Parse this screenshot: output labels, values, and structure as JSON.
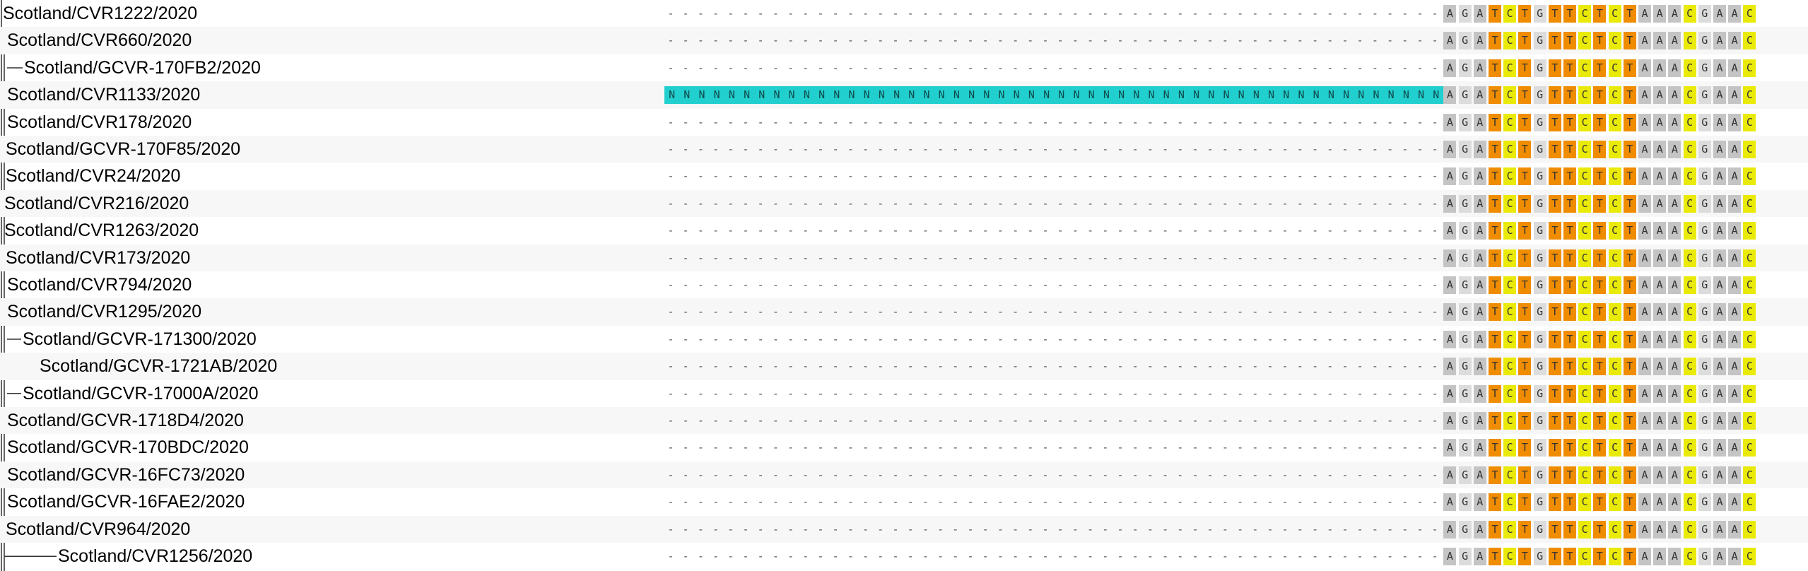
{
  "colors": {
    "A": "#c4c4c4",
    "G": "#dcdcdc",
    "T": "#f08c00",
    "C": "#eaea08",
    "N": "#22cfcf",
    "tree_line": "#333333"
  },
  "consensus_suffix": "AGATCTGTTCTCTAAACGAAC",
  "rows": [
    {
      "name": "Scotland/CVR1222/2020",
      "sequence": "----------------------------------------------------AGATCTGTTCTCTAAACGAAC"
    },
    {
      "name": "Scotland/CVR660/2020",
      "sequence": "----------------------------------------------------AGATCTGTTCTCTAAACGAAC"
    },
    {
      "name": "Scotland/GCVR-170FB2/2020",
      "sequence": "----------------------------------------------------AGATCTGTTCTCTAAACGAAC"
    },
    {
      "name": "Scotland/CVR1133/2020",
      "sequence": "NNNNNNNNNNNNNNNNNNNNNNNNNNNNNNNNNNNNNNNNNNNNNNNNNNNNAGATCTGTTCTCTAAACGAAC"
    },
    {
      "name": "Scotland/CVR178/2020",
      "sequence": "----------------------------------------------------AGATCTGTTCTCTAAACGAAC"
    },
    {
      "name": "Scotland/GCVR-170F85/2020",
      "sequence": "----------------------------------------------------AGATCTGTTCTCTAAACGAAC"
    },
    {
      "name": "Scotland/CVR24/2020",
      "sequence": "----------------------------------------------------AGATCTGTTCTCTAAACGAAC"
    },
    {
      "name": "Scotland/CVR216/2020",
      "sequence": "----------------------------------------------------AGATCTGTTCTCTAAACGAAC"
    },
    {
      "name": "Scotland/CVR1263/2020",
      "sequence": "----------------------------------------------------AGATCTGTTCTCTAAACGAAC"
    },
    {
      "name": "Scotland/CVR173/2020",
      "sequence": "----------------------------------------------------AGATCTGTTCTCTAAACGAAC"
    },
    {
      "name": "Scotland/CVR794/2020",
      "sequence": "----------------------------------------------------AGATCTGTTCTCTAAACGAAC"
    },
    {
      "name": "Scotland/CVR1295/2020",
      "sequence": "----------------------------------------------------AGATCTGTTCTCTAAACGAAC"
    },
    {
      "name": "Scotland/GCVR-171300/2020",
      "sequence": "----------------------------------------------------AGATCTGTTCTCTAAACGAAC"
    },
    {
      "name": "Scotland/GCVR-1721AB/2020",
      "sequence": "----------------------------------------------------AGATCTGTTCTCTAAACGAAC"
    },
    {
      "name": "Scotland/GCVR-17000A/2020",
      "sequence": "----------------------------------------------------AGATCTGTTCTCTAAACGAAC"
    },
    {
      "name": "Scotland/GCVR-1718D4/2020",
      "sequence": "----------------------------------------------------AGATCTGTTCTCTAAACGAAC"
    },
    {
      "name": "Scotland/GCVR-170BDC/2020",
      "sequence": "----------------------------------------------------AGATCTGTTCTCTAAACGAAC"
    },
    {
      "name": "Scotland/GCVR-16FC73/2020",
      "sequence": "----------------------------------------------------AGATCTGTTCTCTAAACGAAC"
    },
    {
      "name": "Scotland/GCVR-16FAE2/2020",
      "sequence": "----------------------------------------------------AGATCTGTTCTCTAAACGAAC"
    },
    {
      "name": "Scotland/CVR964/2020",
      "sequence": "----------------------------------------------------AGATCTGTTCTCTAAACGAAC"
    },
    {
      "name": "Scotland/CVR1256/2020",
      "sequence": "----------------------------------------------------AGATCTGTTCTCTAAACGAAC"
    }
  ]
}
